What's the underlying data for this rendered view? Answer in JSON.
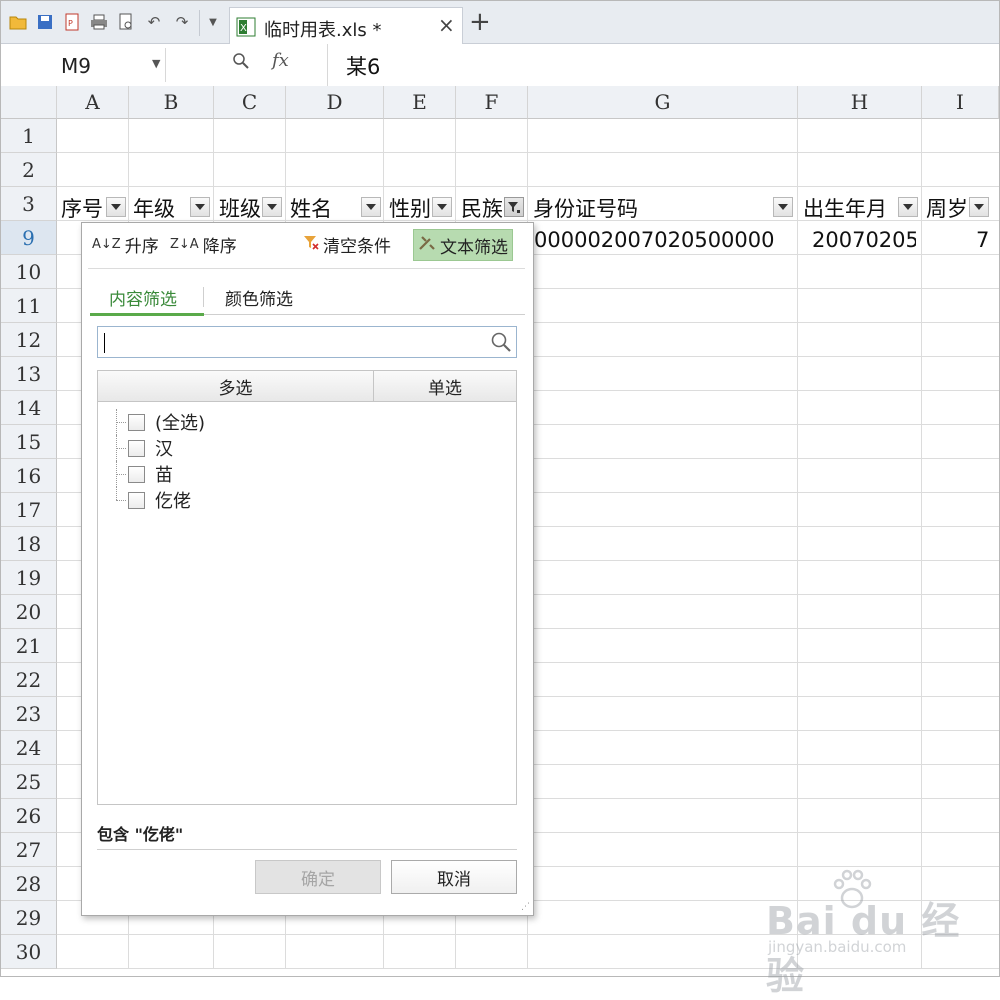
{
  "window": {
    "tab_title": "临时用表.xls *",
    "tab_close": "×",
    "tab_add": "+"
  },
  "formula_bar": {
    "cell_ref": "M9",
    "fx_label": "fx",
    "value": "某6"
  },
  "columns": [
    "A",
    "B",
    "C",
    "D",
    "E",
    "F",
    "G",
    "H",
    "I"
  ],
  "rows": [
    "1",
    "2",
    "3",
    "9",
    "10",
    "11",
    "12",
    "13",
    "14",
    "15",
    "16",
    "17",
    "18",
    "19",
    "20",
    "21",
    "22",
    "23",
    "24",
    "25",
    "26",
    "27",
    "28",
    "29",
    "30"
  ],
  "header_row": {
    "a": "序号",
    "b": "年级",
    "c": "班级",
    "d": "姓名",
    "e": "性别",
    "f": "民族",
    "g": "身份证号码",
    "h": "出生年月",
    "i": "周岁"
  },
  "data_row_9": {
    "g": "000002007020500000",
    "h": "20070205",
    "i": "7"
  },
  "filter_panel": {
    "sort_asc": "升序",
    "sort_desc": "降序",
    "clear": "清空条件",
    "text_filter": "文本筛选",
    "tab_content": "内容筛选",
    "tab_color": "颜色筛选",
    "search_placeholder": "",
    "col_multi": "多选",
    "col_single": "单选",
    "items": [
      "(全选)",
      "汉",
      "苗",
      "仡佬"
    ],
    "condition": "包含 \"仡佬\"",
    "ok": "确定",
    "cancel": "取消"
  },
  "watermark": {
    "logo": "Bai du 经验",
    "url": "jingyan.baidu.com"
  },
  "colors": {
    "accent_green": "#5aaa4a",
    "selected_tool": "#b7dbb0",
    "active_row": "#2a6fb0"
  }
}
